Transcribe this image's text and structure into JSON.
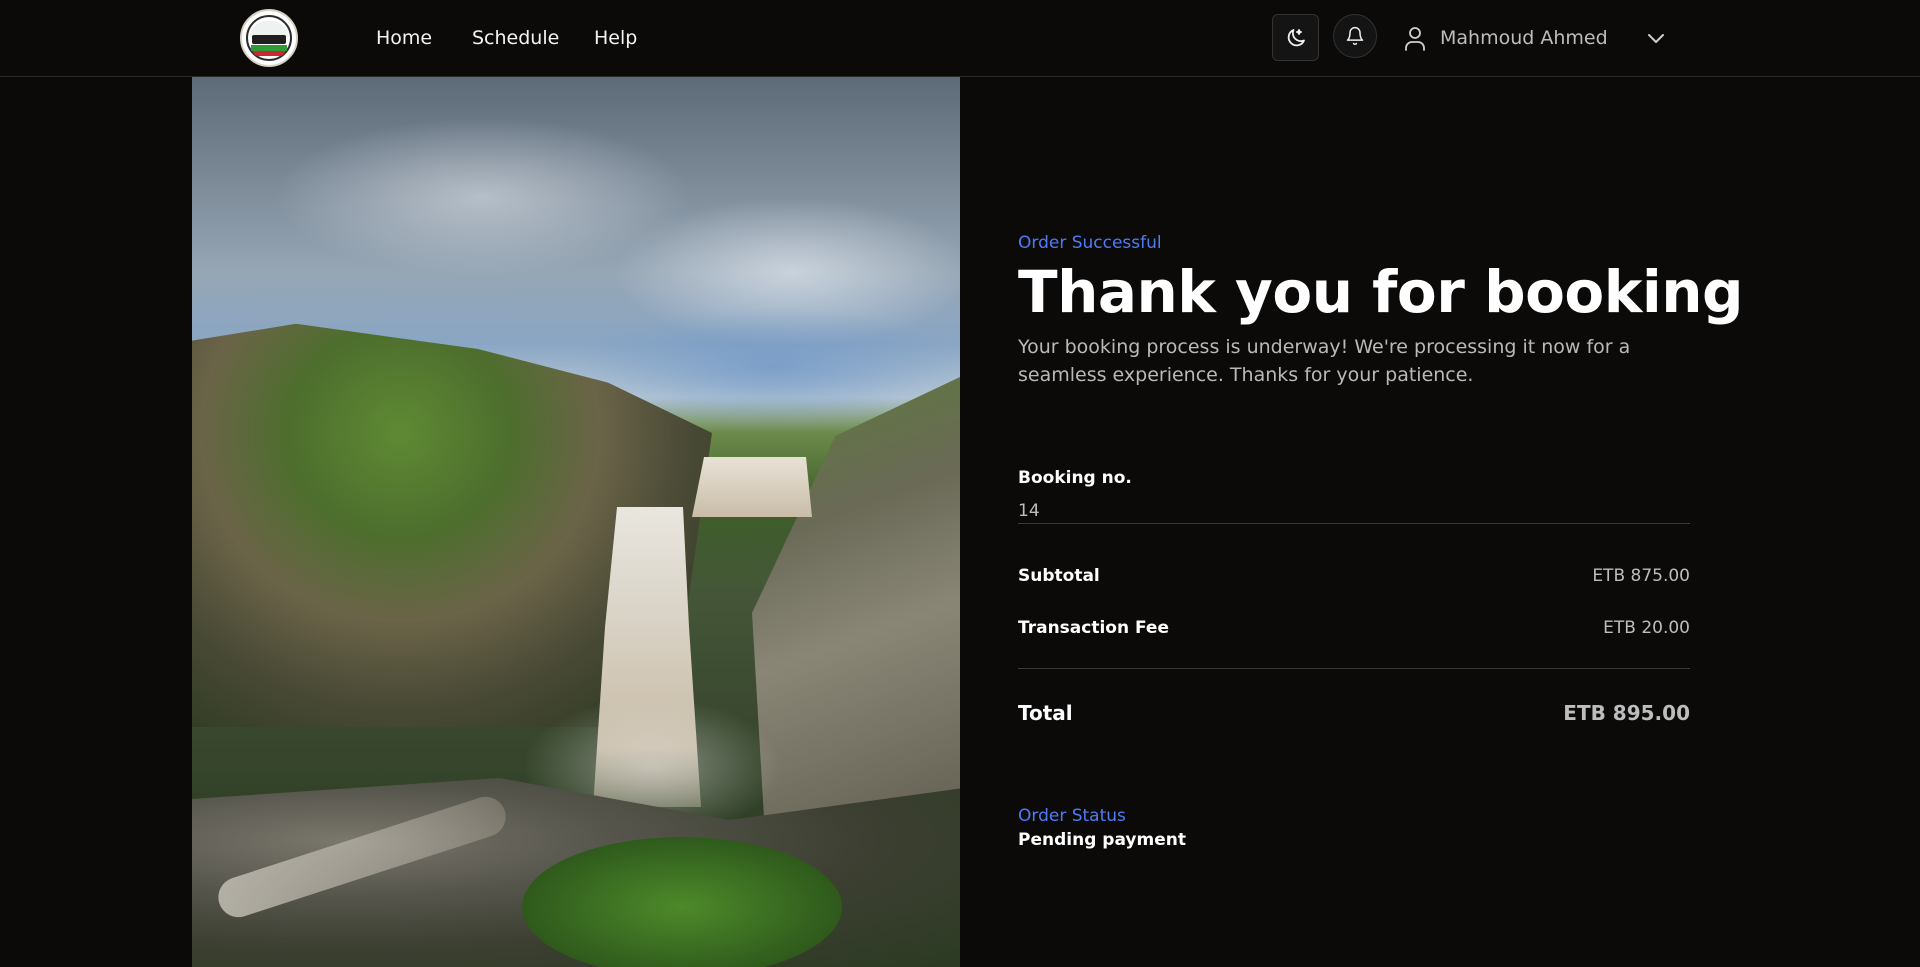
{
  "header": {
    "nav": [
      "Home",
      "Schedule",
      "Help"
    ],
    "user_name": "Mahmoud Ahmed",
    "icons": {
      "logo": "bus-company-logo",
      "theme": "moon-icon",
      "notifications": "bell-icon",
      "user": "user-icon",
      "menu": "chevron-down-icon"
    }
  },
  "confirmation": {
    "eyebrow": "Order Successful",
    "title": "Thank you for booking",
    "subtitle": "Your booking process is underway! We're processing it now for a seamless experience. Thanks for your patience."
  },
  "booking": {
    "label": "Booking no.",
    "value": "14"
  },
  "summary": {
    "subtotal_label": "Subtotal",
    "subtotal_value": "ETB 875.00",
    "fee_label": "Transaction Fee",
    "fee_value": "ETB 20.00",
    "total_label": "Total",
    "total_value": "ETB 895.00"
  },
  "status": {
    "label": "Order Status",
    "value": "Pending payment"
  },
  "colors": {
    "accent": "#4f7bf7",
    "background": "#0b0a09"
  }
}
